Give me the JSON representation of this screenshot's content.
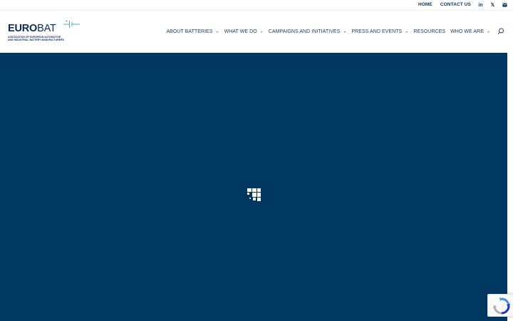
{
  "topbar": {
    "links": [
      {
        "label": "HOME"
      },
      {
        "label": "CONTACT US"
      }
    ],
    "social": [
      {
        "icon": "linkedin-icon",
        "glyph": "in"
      },
      {
        "icon": "x-twitter-icon",
        "glyph": "𝕏"
      },
      {
        "icon": "email-icon",
        "glyph": "✉"
      }
    ]
  },
  "logo": {
    "word_bold": "EURO",
    "word_light": "BAT",
    "tagline": "ASSOCIATION OF EUROPEAN AUTOMOTIVE AND INDUSTRIAL BATTERY MANUFACTURERS"
  },
  "nav": {
    "items": [
      {
        "label": "ABOUT BATTERIES",
        "has_dropdown": true
      },
      {
        "label": "WHAT WE DO",
        "has_dropdown": true
      },
      {
        "label": "CAMPAIGNS AND INITIATIVES",
        "has_dropdown": true
      },
      {
        "label": "PRESS AND EVENTS",
        "has_dropdown": true
      },
      {
        "label": "RESOURCES",
        "has_dropdown": false
      },
      {
        "label": "WHO WE ARE",
        "has_dropdown": true
      }
    ],
    "chevron": "⌄",
    "search_icon": "search-icon"
  },
  "colors": {
    "brand_navy": "#003760",
    "text_navy": "#0a2d57",
    "accent_cyan": "#3aa0d8",
    "white": "#ffffff"
  },
  "hero": {
    "state": "loading",
    "loader_icon": "loading-squares-icon"
  },
  "recaptcha": {
    "icon": "recaptcha-icon"
  }
}
